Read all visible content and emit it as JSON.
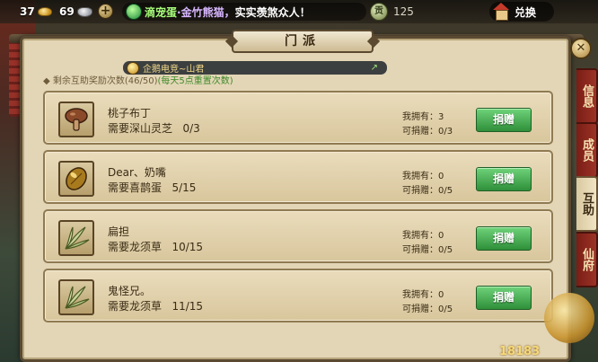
{
  "topbar": {
    "gold": "37",
    "silver": "69",
    "plus": "+",
    "marquee": {
      "part1": "滴宠蛋",
      "part2": "·金竹熊猫，",
      "part3": "实实羡煞众人！"
    },
    "jade_glyph": "贡",
    "jade_value": "125",
    "exchange_label": "兑换"
  },
  "panel": {
    "title": "门派",
    "close": "✕",
    "help_prefix": "◆ 剩余互助奖励次数",
    "help_count": "(46/50)",
    "help_note": "(每天5点重置次数)",
    "news_text": "企鹅电竞~山君",
    "news_arrow": "↗"
  },
  "items": [
    {
      "name": "桃子布丁",
      "need": "需要深山灵芝   0/3",
      "own": "我拥有：3",
      "can": "可捐赠：0/3",
      "button": "捐赠",
      "icon": "mushroom"
    },
    {
      "name": "Dear、奶嘴",
      "need": "需要喜鹊蛋   5/15",
      "own": "我拥有：0",
      "can": "可捐赠：0/5",
      "button": "捐赠",
      "icon": "egg"
    },
    {
      "name": "扁担",
      "need": "需要龙须草   10/15",
      "own": "我拥有：0",
      "can": "可捐赠：0/5",
      "button": "捐赠",
      "icon": "grass"
    },
    {
      "name": "鬼怪兄。",
      "need": "需要龙须草   11/15",
      "own": "我拥有：0",
      "can": "可捐赠：0/5",
      "button": "捐赠",
      "icon": "grass"
    }
  ],
  "tabs": [
    {
      "label": "信息",
      "active": false
    },
    {
      "label": "成员",
      "active": false
    },
    {
      "label": "互助",
      "active": true
    },
    {
      "label": "仙府",
      "active": false
    }
  ],
  "watermark": "18183"
}
